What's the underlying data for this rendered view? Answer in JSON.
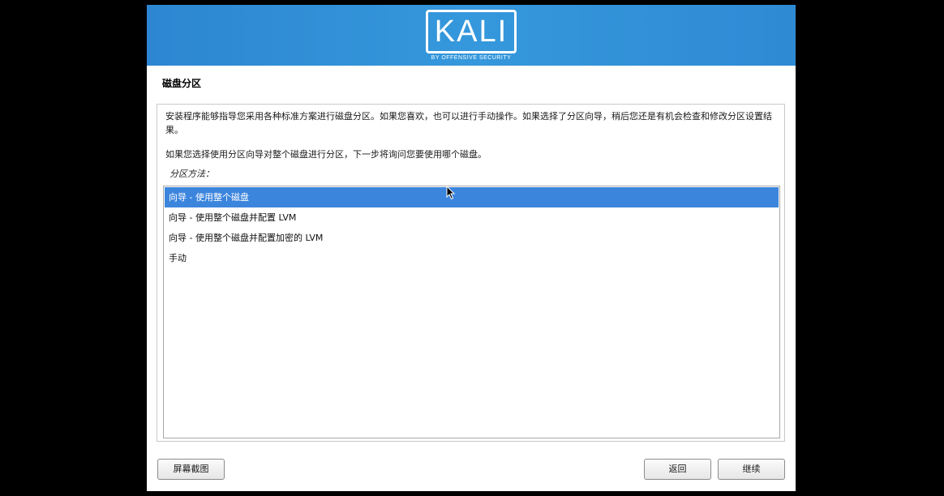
{
  "banner": {
    "logo_text": "KALI",
    "tagline": "BY OFFENSIVE SECURITY"
  },
  "page": {
    "title": "磁盘分区"
  },
  "content": {
    "description_1": "安装程序能够指导您采用各种标准方案进行磁盘分区。如果您喜欢，也可以进行手动操作。如果选择了分区向导，稍后您还是有机会检查和修改分区设置结果。",
    "description_2": "如果您选择使用分区向导对整个磁盘进行分区，下一步将询问您要使用哪个磁盘。",
    "method_label": "分区方法："
  },
  "partition_options": [
    {
      "label": "向导 - 使用整个磁盘",
      "selected": true
    },
    {
      "label": "向导 - 使用整个磁盘并配置 LVM",
      "selected": false
    },
    {
      "label": "向导 - 使用整个磁盘并配置加密的 LVM",
      "selected": false
    },
    {
      "label": "手动",
      "selected": false
    }
  ],
  "buttons": {
    "screenshot": "屏幕截图",
    "back": "返回",
    "continue": "继续"
  },
  "colors": {
    "banner": "#3598dc",
    "selection": "#3c85dd"
  },
  "icons": {
    "cursor": "mouse-pointer-icon"
  }
}
